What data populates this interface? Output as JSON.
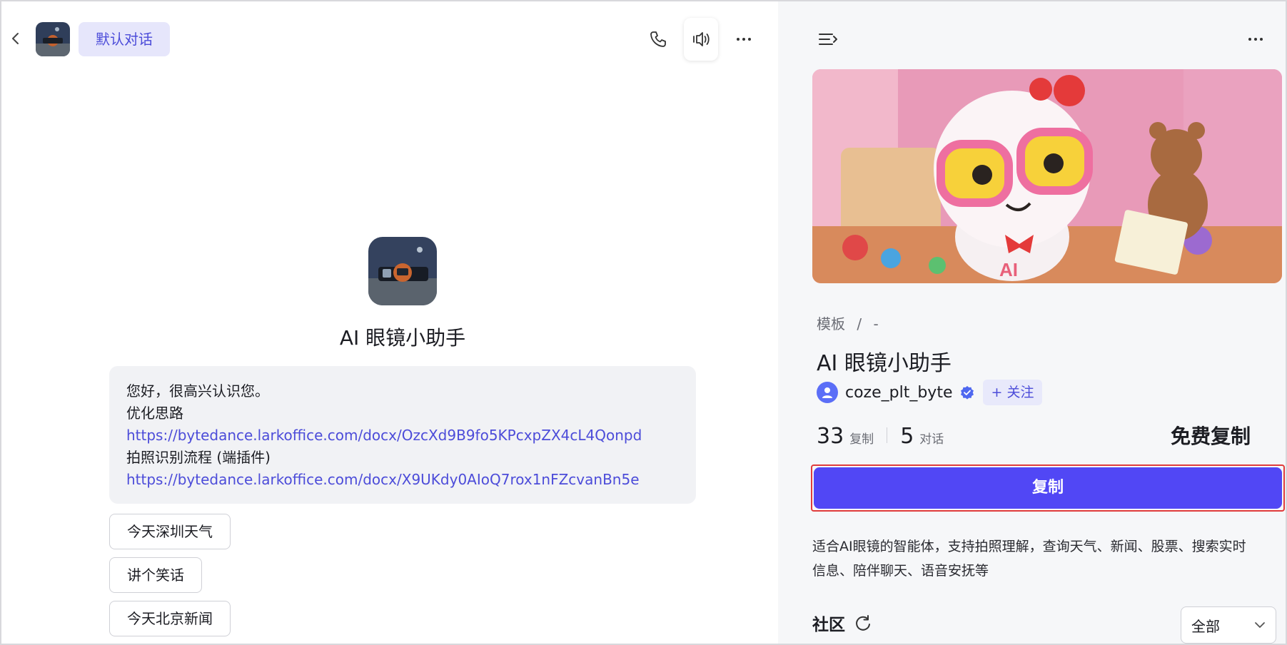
{
  "header": {
    "conversation_tag": "默认对话"
  },
  "bot": {
    "name": "AI 眼镜小助手",
    "welcome_lines": {
      "greeting": "您好，很高兴认识您。",
      "section1": "优化思路",
      "link1": "https://bytedance.larkoffice.com/docx/OzcXd9B9fo5KPcxpZX4cL4Qonpd",
      "section2": "拍照识别流程 (端插件)",
      "link2": "https://bytedance.larkoffice.com/docx/X9UKdy0AIoQ7rox1nFZcvanBn5e"
    },
    "suggestions": [
      "今天深圳天气",
      "讲个笑话",
      "今天北京新闻"
    ]
  },
  "detail": {
    "breadcrumb": [
      "模板",
      "/",
      "-"
    ],
    "title": "AI 眼镜小助手",
    "author": "coze_plt_byte",
    "follow_label": "+ 关注",
    "stats": {
      "copies_value": "33",
      "copies_label": "复制",
      "chats_value": "5",
      "chats_label": "对话"
    },
    "price_label": "免费复制",
    "copy_button": "复制",
    "description": "适合AI眼镜的智能体，支持拍照理解，查询天气、新闻、股票、搜索实时信息、陪伴聊天、语音安抚等",
    "community_label": "社区",
    "filter_value": "全部"
  },
  "colors": {
    "accent": "#5147f5",
    "link": "#4c4cd9",
    "tag_bg": "#e6e6fb",
    "highlight_border": "#e03b3b"
  },
  "icons": [
    "back-icon",
    "phone-icon",
    "speaker-icon",
    "more-icon",
    "menu-collapse-icon",
    "verified-icon",
    "refresh-icon",
    "chevron-down-icon"
  ]
}
